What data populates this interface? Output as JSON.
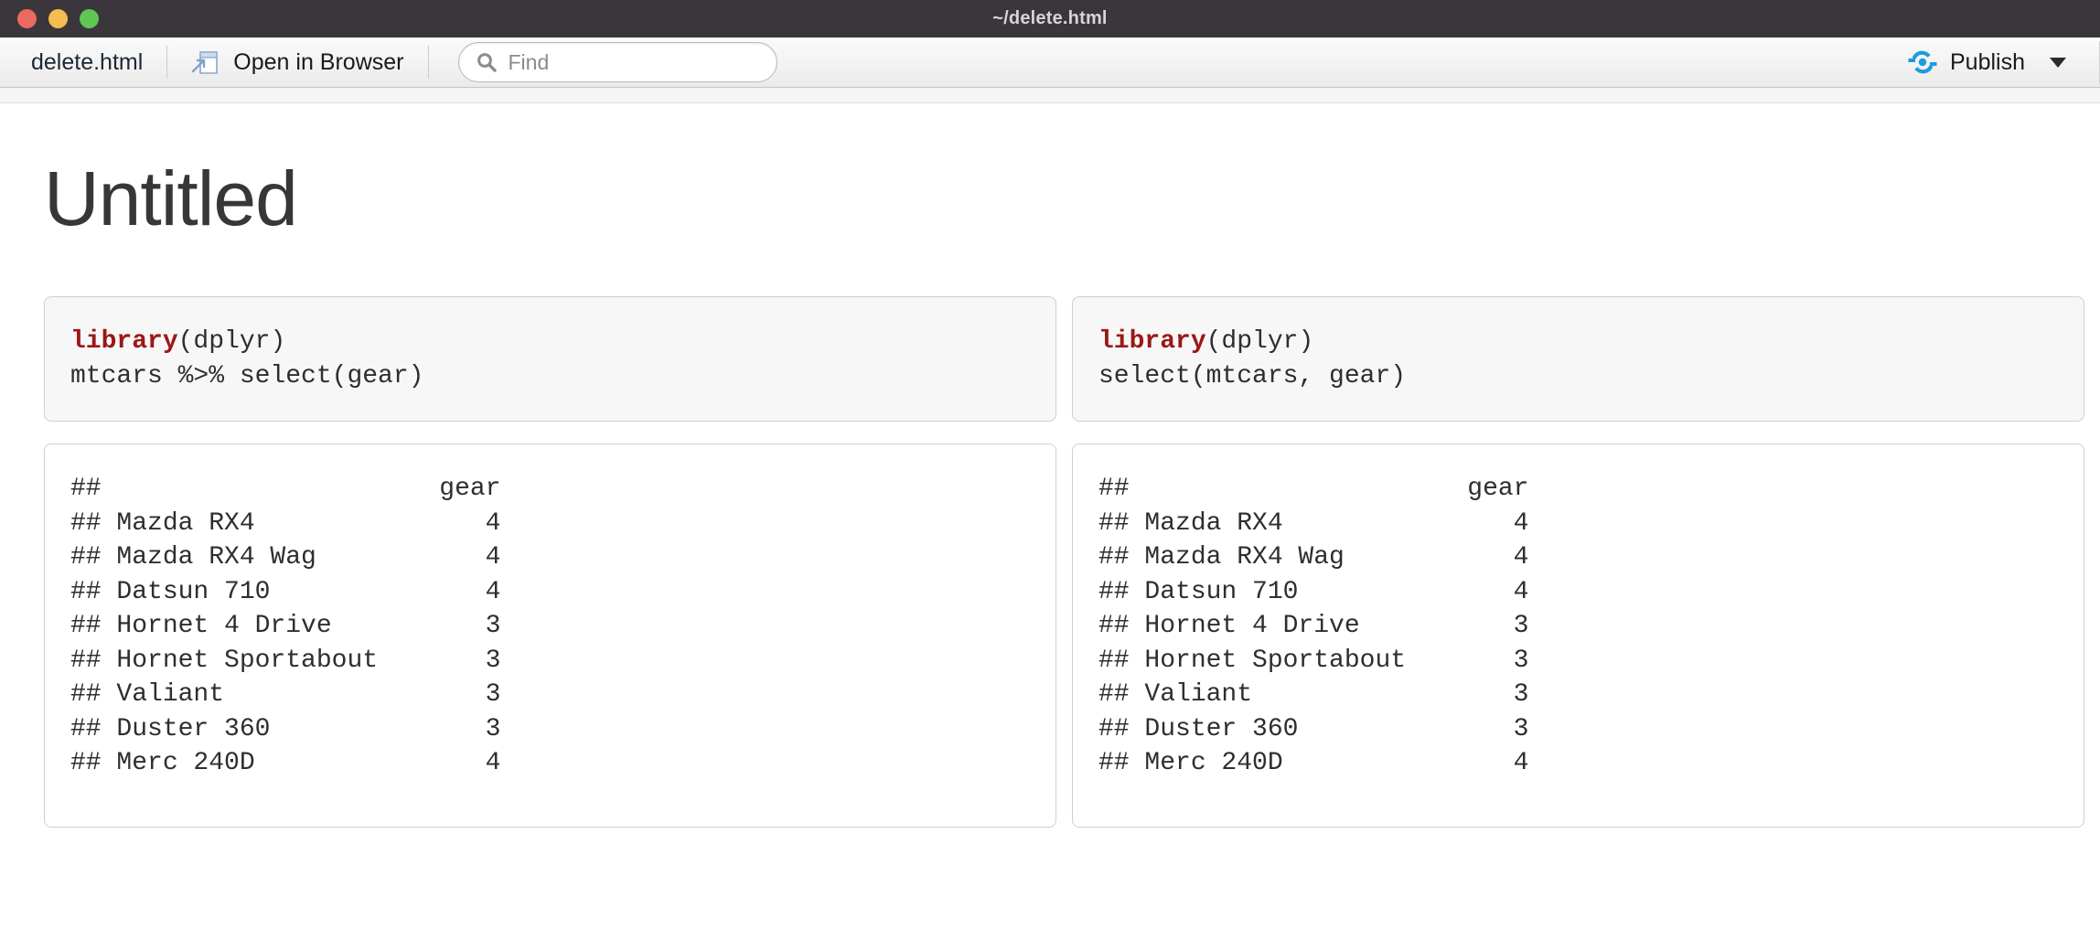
{
  "window": {
    "title": "~/delete.html",
    "traffic_lights": [
      "close-button",
      "minimize-button",
      "maximize-button"
    ],
    "colors": {
      "close": "#ec6a5f",
      "minimize": "#f4bd4f",
      "maximize": "#61c554",
      "titlebar_bg": "#3b363c"
    }
  },
  "toolbar": {
    "filename": "delete.html",
    "open_in_browser_label": "Open in Browser",
    "open_in_browser_icon": "external-page-icon",
    "find_placeholder": "Find",
    "find_value": "",
    "find_icon": "search-icon",
    "publish_label": "Publish",
    "publish_icon": "publish-icon",
    "publish_icon_color": "#1d9bdd",
    "publish_caret_icon": "chevron-down-icon"
  },
  "document": {
    "title": "Untitled",
    "code_blocks": [
      {
        "keyword": "library",
        "after_keyword": "(dplyr)",
        "line2": "mtcars %>% select(gear)"
      },
      {
        "keyword": "library",
        "after_keyword": "(dplyr)",
        "line2": "select(mtcars, gear)"
      }
    ],
    "output_blocks": [
      {
        "lines": [
          "##                      gear",
          "## Mazda RX4               4",
          "## Mazda RX4 Wag           4",
          "## Datsun 710              4",
          "## Hornet 4 Drive          3",
          "## Hornet Sportabout       3",
          "## Valiant                 3",
          "## Duster 360              3",
          "## Merc 240D               4"
        ]
      },
      {
        "lines": [
          "##                      gear",
          "## Mazda RX4               4",
          "## Mazda RX4 Wag           4",
          "## Datsun 710              4",
          "## Hornet 4 Drive          3",
          "## Hornet Sportabout       3",
          "## Valiant                 3",
          "## Duster 360              3",
          "## Merc 240D               4"
        ]
      }
    ]
  }
}
